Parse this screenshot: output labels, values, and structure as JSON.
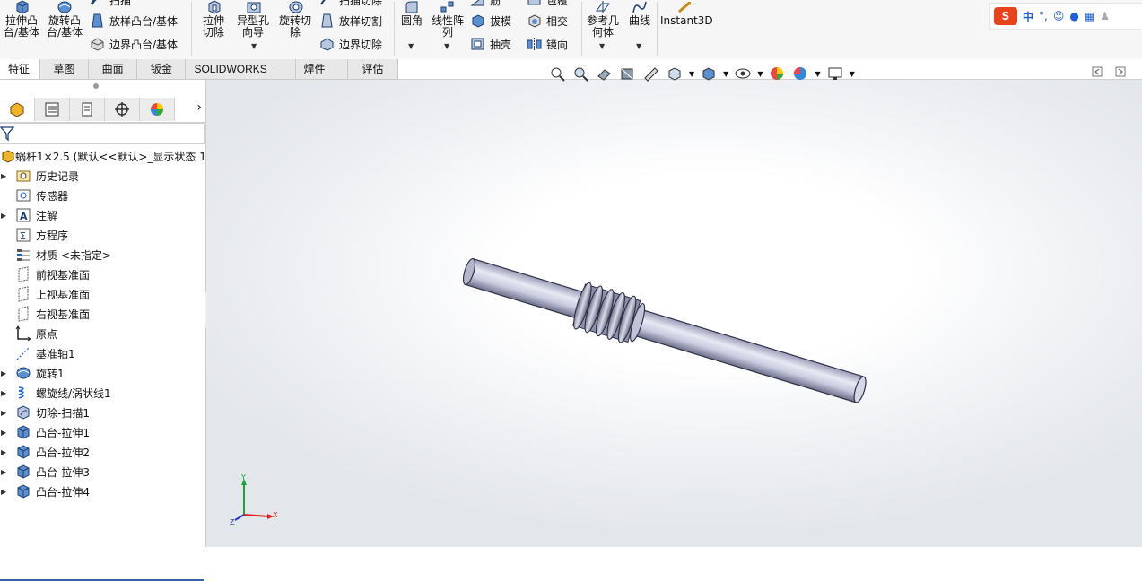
{
  "ribbon": {
    "extrude_boss": "拉伸凸台/基体",
    "revolve_boss": "旋转凸台/基体",
    "sweep_boss": "扫描",
    "loft_boss": "放样凸台/基体",
    "boundary_boss": "边界凸台/基体",
    "extrude_cut": "拉伸切除",
    "hole_wizard": "异型孔向导",
    "revolve_cut": "旋转切除",
    "sweep_cut": "扫描切除",
    "loft_cut": "放样切割",
    "boundary_cut": "边界切除",
    "fillet": "圆角",
    "linear_pattern": "线性阵列",
    "rib": "筋",
    "draft": "拔模",
    "shell": "抽壳",
    "wrap": "包覆",
    "intersect": "相交",
    "mirror": "镜向",
    "ref_geometry": "参考几何体",
    "curves": "曲线",
    "instant3d": "Instant3D"
  },
  "ime": {
    "lang": "中",
    "punct": "°,"
  },
  "tabs": [
    "特征",
    "草图",
    "曲面",
    "钣金",
    "SOLIDWORKS MBD",
    "焊件(D)",
    "评估"
  ],
  "tree": {
    "root": "蜗杆1×2.5  (默认<<默认>_显示状态 1",
    "items": [
      {
        "label": "历史记录",
        "icon": "history-folder-icon",
        "expand": true
      },
      {
        "label": "传感器",
        "icon": "sensor-icon",
        "expand": false
      },
      {
        "label": "注解",
        "icon": "annotation-icon",
        "expand": true
      },
      {
        "label": "方程序",
        "icon": "equation-icon",
        "expand": false
      },
      {
        "label": "材质 <未指定>",
        "icon": "material-icon",
        "expand": false
      },
      {
        "label": "前视基准面",
        "icon": "plane-icon",
        "expand": false
      },
      {
        "label": "上视基准面",
        "icon": "plane-icon",
        "expand": false
      },
      {
        "label": "右视基准面",
        "icon": "plane-icon",
        "expand": false
      },
      {
        "label": "原点",
        "icon": "origin-icon",
        "expand": false
      },
      {
        "label": "基准轴1",
        "icon": "axis-icon",
        "expand": false
      },
      {
        "label": "旋转1",
        "icon": "revolve-feature-icon",
        "expand": true
      },
      {
        "label": "螺旋线/涡状线1",
        "icon": "helix-icon",
        "expand": true
      },
      {
        "label": "切除-扫描1",
        "icon": "cut-sweep-icon",
        "expand": true
      },
      {
        "label": "凸台-拉伸1",
        "icon": "extrude-feature-icon",
        "expand": true
      },
      {
        "label": "凸台-拉伸2",
        "icon": "extrude-feature-icon",
        "expand": true
      },
      {
        "label": "凸台-拉伸3",
        "icon": "extrude-feature-icon",
        "expand": true
      },
      {
        "label": "凸台-拉伸4",
        "icon": "extrude-feature-icon",
        "expand": true
      }
    ]
  },
  "triad": {
    "x": "X",
    "y": "Y",
    "z": "Z"
  },
  "colors": {
    "accent": "#3a5fa8",
    "part": "#c9cbe0",
    "part_dark": "#4a4d63"
  }
}
